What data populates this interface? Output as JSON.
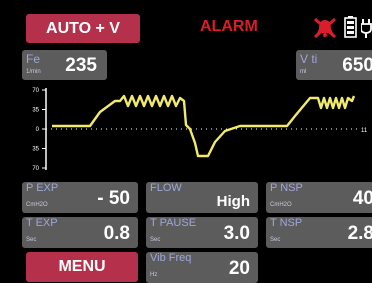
{
  "header": {
    "mode_label": "AUTO + V",
    "alarm_label": "ALARM",
    "icons": [
      "alarm-bell-muted-icon",
      "battery-icon",
      "power-plug-icon"
    ],
    "alarm_color": "#d81e2a"
  },
  "monitors": {
    "fe": {
      "label": "Fe",
      "unit": "1/min",
      "value": "235"
    },
    "vti": {
      "label": "V ti",
      "unit": "ml",
      "value": "650"
    }
  },
  "chart_data": {
    "type": "line",
    "yticks": [
      "70",
      "35",
      "0",
      "35",
      "70"
    ],
    "ylim": [
      -70,
      70
    ],
    "right_tick": "11",
    "series_color": "#f1ea6a"
  },
  "params": {
    "p_exp": {
      "label": "P EXP",
      "unit": "CmH2O",
      "value": "- 50"
    },
    "flow": {
      "label": "FLOW",
      "value": "High"
    },
    "p_nsp": {
      "label": "P NSP",
      "unit": "CmH2O",
      "value": "40"
    },
    "t_exp": {
      "label": "T EXP",
      "unit": "Sec",
      "value": "0.8"
    },
    "t_pause": {
      "label": "T PAUSE",
      "unit": "Sec",
      "value": "3.0"
    },
    "t_nsp": {
      "label": "T NSP",
      "unit": "Sec",
      "value": "2.8"
    },
    "vib_freq": {
      "label": "Vib Freq",
      "unit": "Hz",
      "value": "20"
    }
  },
  "footer": {
    "menu_label": "MENU"
  },
  "colors": {
    "accent": "#b5314b",
    "panel": "#5c5c5c",
    "label": "#9ea6d6",
    "waveform": "#f1ea6a"
  }
}
